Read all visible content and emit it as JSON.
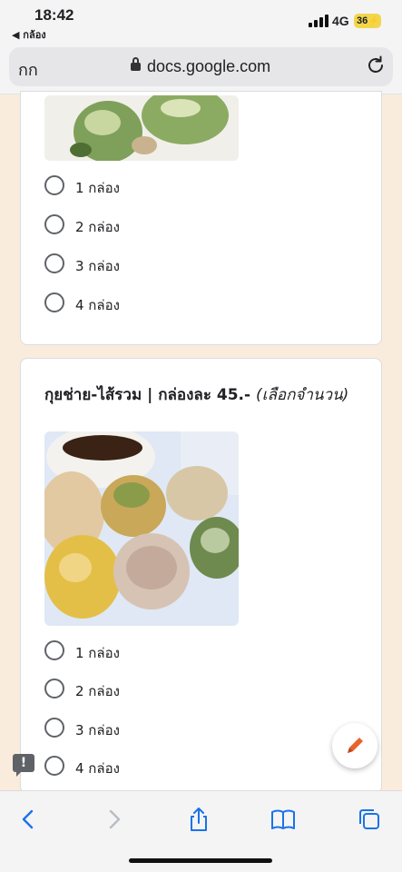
{
  "status_bar": {
    "time": "18:42",
    "back_app": "◀ กล้อง",
    "network": "4G",
    "battery": "36"
  },
  "browser": {
    "aa_button": "กก",
    "domain": "docs.google.com"
  },
  "question1": {
    "options": [
      "1 กล่อง",
      "2 กล่อง",
      "3 กล่อง",
      "4 กล่อง"
    ]
  },
  "question2": {
    "title": "กุยช่าย-ไส้รวม | กล่องละ 45.-",
    "note": "(เลือกจำนวน)",
    "options": [
      "1 กล่อง",
      "2 กล่อง",
      "3 กล่อง",
      "4 กล่อง"
    ]
  },
  "feedback_glyph": "!",
  "icons": [
    "back-icon",
    "forward-icon",
    "share-icon",
    "bookmarks-icon",
    "tabs-icon",
    "edit-pencil-icon",
    "reload-icon",
    "lock-icon",
    "feedback-icon"
  ],
  "colors": {
    "page_background": "#f9ecdc",
    "card": "#ffffff",
    "pencil_accent": "#e8642c",
    "browser_blue": "#1a73e8"
  }
}
